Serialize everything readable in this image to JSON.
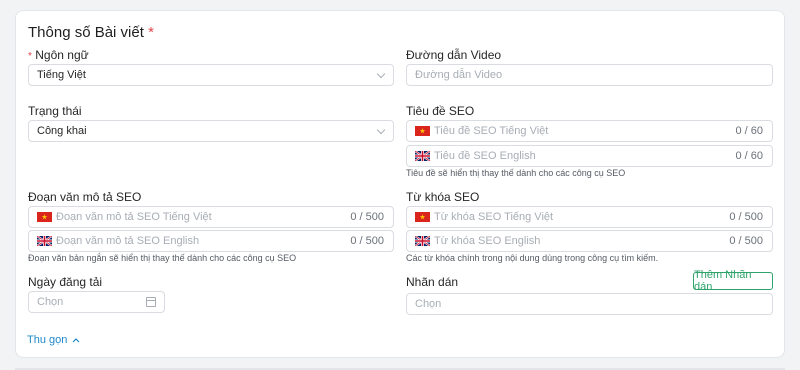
{
  "section": {
    "title": "Thông số Bài viết",
    "required_mark": "*"
  },
  "language": {
    "required_mark": "*",
    "label": "Ngôn ngữ",
    "value": "Tiếng Việt"
  },
  "video": {
    "label": "Đường dẫn Video",
    "placeholder": "Đường dẫn Video"
  },
  "status": {
    "label": "Trạng thái",
    "value": "Công khai"
  },
  "seo_title": {
    "label": "Tiêu đề SEO",
    "vi_placeholder": "Tiêu đề SEO Tiếng Việt",
    "vi_count": "0 / 60",
    "en_placeholder": "Tiêu đề SEO English",
    "en_count": "0 / 60",
    "hint": "Tiêu đề sẽ hiển thị thay thế dành cho các công cụ SEO"
  },
  "seo_desc": {
    "label": "Đoạn văn mô tả SEO",
    "vi_placeholder": "Đoạn văn mô tả SEO Tiếng Việt",
    "vi_count": "0 / 500",
    "en_placeholder": "Đoạn văn mô tả SEO English",
    "en_count": "0 / 500",
    "hint": "Đoạn văn bản ngắn sẽ hiển thị thay thế dành cho các công cụ SEO"
  },
  "seo_keywords": {
    "label": "Từ khóa SEO",
    "vi_placeholder": "Từ khóa SEO Tiếng Việt",
    "vi_count": "0 / 500",
    "en_placeholder": "Từ khóa SEO English",
    "en_count": "0 / 500",
    "hint": "Các từ khóa chính trong nội dung dùng trong công cụ tìm kiếm."
  },
  "publish_date": {
    "label": "Ngày đăng tải",
    "placeholder": "Chọn"
  },
  "tags": {
    "label": "Nhãn dán",
    "placeholder": "Chọn",
    "add_button": "Thêm Nhãn dán"
  },
  "collapse_label": "Thu gọn",
  "colors": {
    "accent_green": "#2fa36b",
    "link_blue": "#1e88c8",
    "required_red": "#e5484d"
  },
  "icons": {
    "flag_vi": "vietnam-flag-icon",
    "flag_en": "uk-flag-icon",
    "chevron": "chevron-down-icon",
    "calendar": "calendar-icon",
    "caret_up": "chevron-up-icon"
  }
}
